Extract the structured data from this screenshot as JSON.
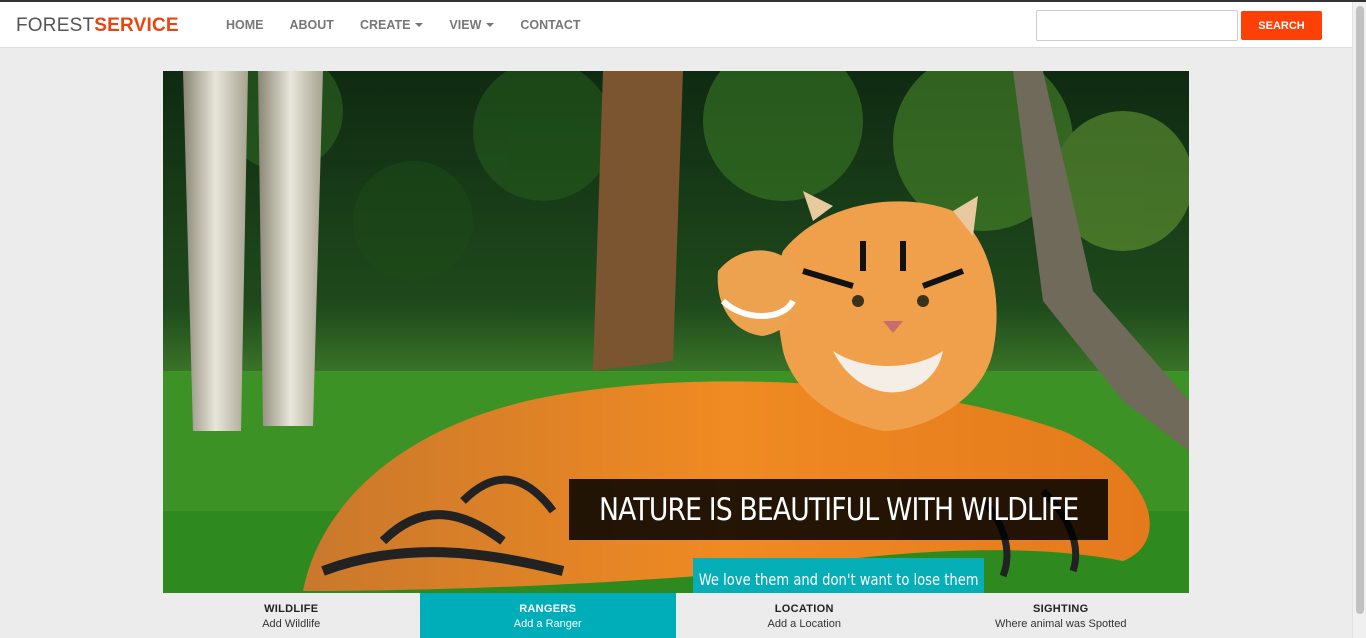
{
  "brand": {
    "part1": "FOREST",
    "part2": "SERVICE"
  },
  "nav": {
    "home": "HOME",
    "about": "ABOUT",
    "create": "CREATE",
    "view": "VIEW",
    "contact": "CONTACT"
  },
  "search": {
    "placeholder": "",
    "value": "",
    "button": "SEARCH"
  },
  "hero": {
    "title": "NATURE IS BEAUTIFUL WITH WILDLIFE",
    "subtitle": "We love them and don't want to lose them"
  },
  "tabs": [
    {
      "title": "WILDLIFE",
      "desc": "Add Wildlife"
    },
    {
      "title": "RANGERS",
      "desc": "Add a Ranger"
    },
    {
      "title": "LOCATION",
      "desc": "Add a Location"
    },
    {
      "title": "SIGHTING",
      "desc": "Where animal was Spotted"
    }
  ],
  "colors": {
    "accent": "#fd3f08",
    "teal": "#00aeb9",
    "brand_dark": "#555555"
  }
}
